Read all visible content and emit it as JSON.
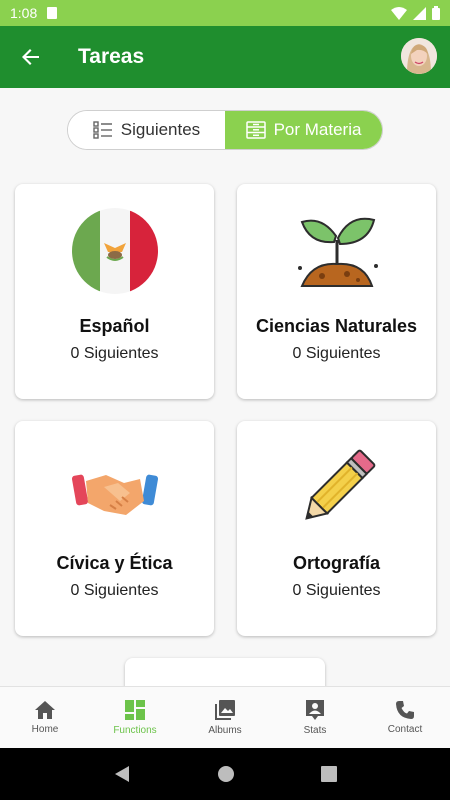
{
  "status_bar": {
    "time": "1:08"
  },
  "app_bar": {
    "title": "Tareas"
  },
  "toggle": {
    "options": [
      {
        "label": "Siguientes",
        "active": false
      },
      {
        "label": "Por Materia",
        "active": true
      }
    ]
  },
  "subjects": [
    {
      "name": "Español",
      "count": "0 Siguientes",
      "icon": "mexico-flag-icon"
    },
    {
      "name": "Ciencias Naturales",
      "count": "0 Siguientes",
      "icon": "sprout-icon"
    },
    {
      "name": "Cívica y Ética",
      "count": "0 Siguientes",
      "icon": "handshake-icon"
    },
    {
      "name": "Ortografía",
      "count": "0 Siguientes",
      "icon": "pencil-icon"
    }
  ],
  "bottom_nav": [
    {
      "label": "Home",
      "icon": "home-icon",
      "active": false
    },
    {
      "label": "Functions",
      "icon": "dashboard-icon",
      "active": true
    },
    {
      "label": "Albums",
      "icon": "photo-library-icon",
      "active": false
    },
    {
      "label": "Stats",
      "icon": "stats-icon",
      "active": false
    },
    {
      "label": "Contact",
      "icon": "phone-icon",
      "active": false
    }
  ],
  "colors": {
    "status_bar": "#8bd14f",
    "app_bar": "#1f8e2e",
    "accent": "#8bd14f",
    "nav_active": "#6cc34a"
  }
}
